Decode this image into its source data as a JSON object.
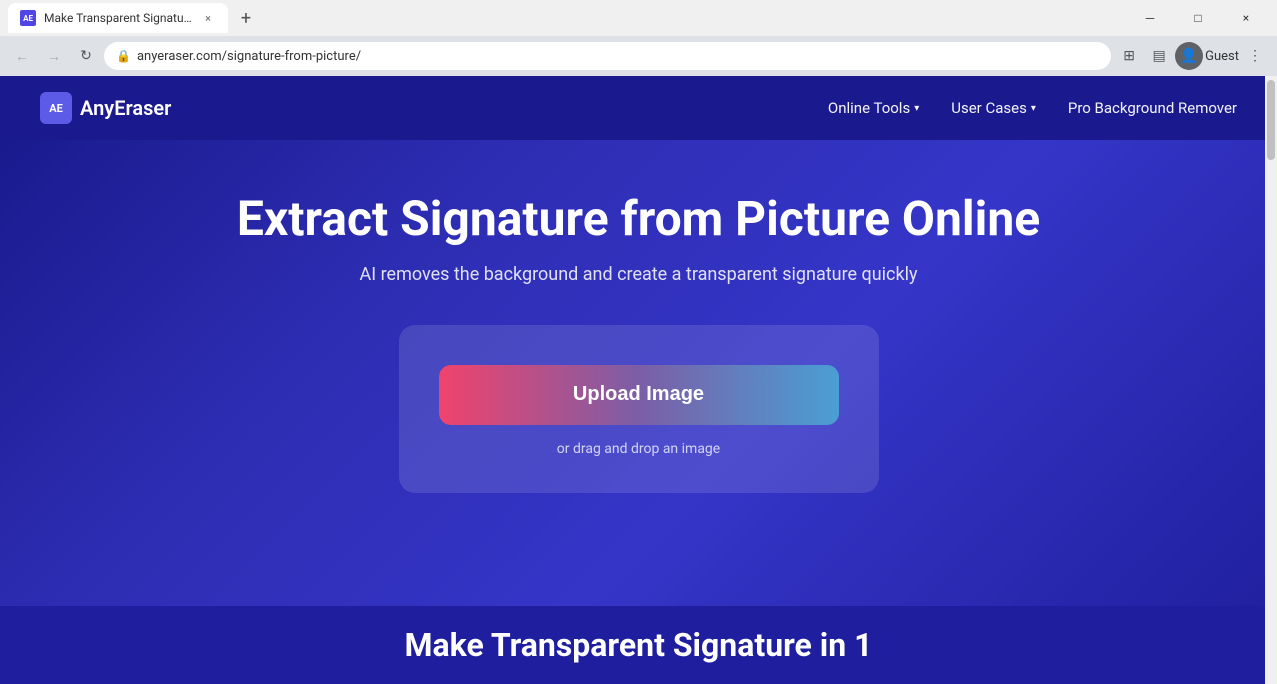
{
  "browser": {
    "tab": {
      "favicon": "AE",
      "title": "Make Transparent Signature fr",
      "close": "×"
    },
    "new_tab": "+",
    "window_controls": {
      "minimize": "─",
      "maximize": "□",
      "close": "×"
    },
    "nav": {
      "back": "←",
      "forward": "→",
      "refresh": "↻",
      "address": "anyeraser.com/signature-from-picture/",
      "lock_icon": "🔒"
    },
    "toolbar_right": {
      "extensions": "⊞",
      "sidebar": "▤",
      "guest": "Guest",
      "menu": "⋮"
    }
  },
  "site": {
    "nav": {
      "logo_text": "AnyEraser",
      "logo_abbr": "AE",
      "links": [
        {
          "label": "Online Tools",
          "has_dropdown": true
        },
        {
          "label": "User Cases",
          "has_dropdown": true
        },
        {
          "label": "Pro Background Remover",
          "has_dropdown": false
        }
      ]
    },
    "hero": {
      "title": "Extract Signature from Picture Online",
      "subtitle": "AI removes the background and create a transparent signature quickly",
      "upload_button": "Upload Image",
      "drag_drop": "or drag and drop an image"
    },
    "bottom": {
      "title": "Make Transparent Signature in 1"
    }
  }
}
